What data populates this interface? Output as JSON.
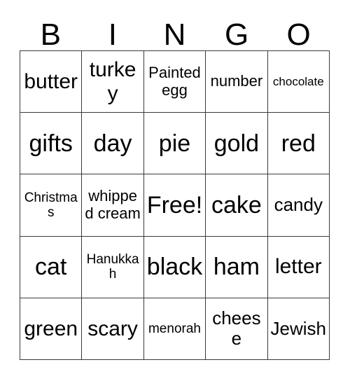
{
  "card": {
    "title": "Bingo Card",
    "headers": [
      "B",
      "I",
      "N",
      "G",
      "O"
    ],
    "free_space_label": "Free!",
    "colors": {
      "background": "#ffffff",
      "text": "#000000",
      "grid_line": "#3a3a3a"
    },
    "grid": {
      "rows": 5,
      "columns": 5,
      "cells": [
        [
          {
            "text": "butter",
            "size": "lg"
          },
          {
            "text": "turkey",
            "size": "lg"
          },
          {
            "text": "Painted egg",
            "size": "sm"
          },
          {
            "text": "number",
            "size": "sm"
          },
          {
            "text": "chocolate",
            "size": "xxs"
          }
        ],
        [
          {
            "text": "gifts",
            "size": "xl"
          },
          {
            "text": "day",
            "size": "xl"
          },
          {
            "text": "pie",
            "size": "xl"
          },
          {
            "text": "gold",
            "size": "xl"
          },
          {
            "text": "red",
            "size": "xl"
          }
        ],
        [
          {
            "text": "Christmas",
            "size": "xs"
          },
          {
            "text": "whipped cream",
            "size": "sm"
          },
          {
            "text": "Free!",
            "size": "xl"
          },
          {
            "text": "cake",
            "size": "xl"
          },
          {
            "text": "candy",
            "size": "md"
          }
        ],
        [
          {
            "text": "cat",
            "size": "xl"
          },
          {
            "text": "Hanukkah",
            "size": "xs"
          },
          {
            "text": "black",
            "size": "xl"
          },
          {
            "text": "ham",
            "size": "xl"
          },
          {
            "text": "letter",
            "size": "lg"
          }
        ],
        [
          {
            "text": "green",
            "size": "lg"
          },
          {
            "text": "scary",
            "size": "lg"
          },
          {
            "text": "menorah",
            "size": "xs"
          },
          {
            "text": "cheese",
            "size": "md"
          },
          {
            "text": "Jewish",
            "size": "md"
          }
        ]
      ]
    }
  }
}
